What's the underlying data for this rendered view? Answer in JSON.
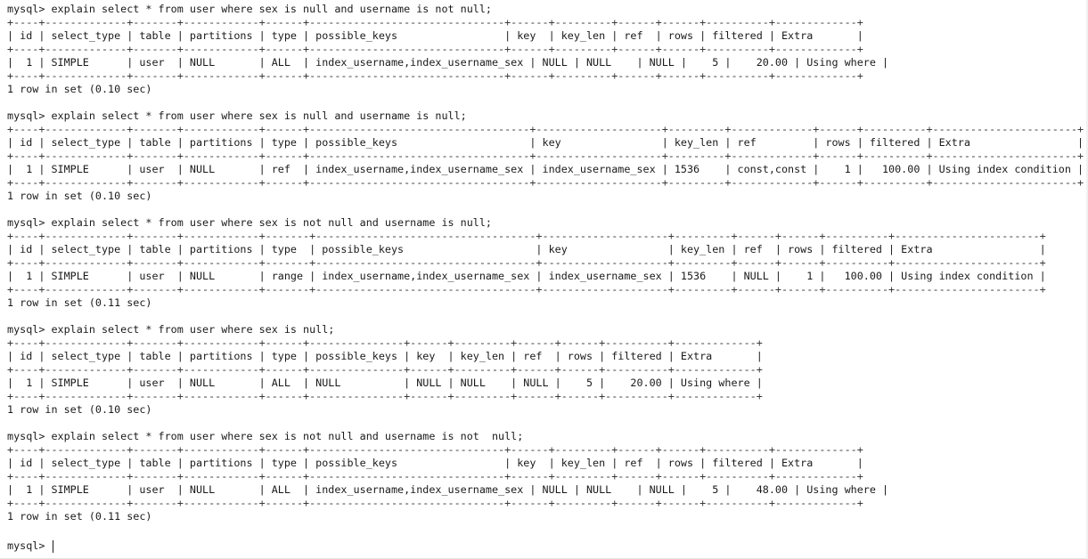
{
  "terminal": {
    "lines": [
      "mysql> explain select * from user where sex is null and username is not null;",
      "+----+-------------+-------+------------+------+-------------------------------+------+---------+------+------+----------+-------------+",
      "| id | select_type | table | partitions | type | possible_keys                 | key  | key_len | ref  | rows | filtered | Extra       |",
      "+----+-------------+-------+------------+------+-------------------------------+------+---------+------+------+----------+-------------+",
      "|  1 | SIMPLE      | user  | NULL       | ALL  | index_username,index_username_sex | NULL | NULL    | NULL |    5 |    20.00 | Using where |",
      "+----+-------------+-------+------------+------+-------------------------------+------+---------+------+------+----------+-------------+",
      "1 row in set (0.10 sec)",
      "",
      "mysql> explain select * from user where sex is null and username is null;",
      "+----+-------------+-------+------------+------+-----------------------------------+--------------------+---------+-------------+------+----------+-----------------------+",
      "| id | select_type | table | partitions | type | possible_keys                     | key                | key_len | ref         | rows | filtered | Extra                 |",
      "+----+-------------+-------+------------+------+-----------------------------------+--------------------+---------+-------------+------+----------+-----------------------+",
      "|  1 | SIMPLE      | user  | NULL       | ref  | index_username,index_username_sex | index_username_sex | 1536    | const,const |    1 |   100.00 | Using index condition |",
      "+----+-------------+-------+------------+------+-----------------------------------+--------------------+---------+-------------+------+----------+-----------------------+",
      "1 row in set (0.10 sec)",
      "",
      "mysql> explain select * from user where sex is not null and username is null;",
      "+----+-------------+-------+------------+-------+-----------------------------------+--------------------+---------+------+------+----------+-----------------------+",
      "| id | select_type | table | partitions | type  | possible_keys                     | key                | key_len | ref  | rows | filtered | Extra                 |",
      "+----+-------------+-------+------------+-------+-----------------------------------+--------------------+---------+------+------+----------+-----------------------+",
      "|  1 | SIMPLE      | user  | NULL       | range | index_username,index_username_sex | index_username_sex | 1536    | NULL |    1 |   100.00 | Using index condition |",
      "+----+-------------+-------+------------+-------+-----------------------------------+--------------------+---------+------+------+----------+-----------------------+",
      "1 row in set (0.11 sec)",
      "",
      "mysql> explain select * from user where sex is null;",
      "+----+-------------+-------+------------+------+---------------+------+---------+------+------+----------+-------------+",
      "| id | select_type | table | partitions | type | possible_keys | key  | key_len | ref  | rows | filtered | Extra       |",
      "+----+-------------+-------+------------+------+---------------+------+---------+------+------+----------+-------------+",
      "|  1 | SIMPLE      | user  | NULL       | ALL  | NULL          | NULL | NULL    | NULL |    5 |    20.00 | Using where |",
      "+----+-------------+-------+------------+------+---------------+------+---------+------+------+----------+-------------+",
      "1 row in set (0.10 sec)",
      "",
      "mysql> explain select * from user where sex is not null and username is not  null;",
      "+----+-------------+-------+------------+------+-------------------------------+------+---------+------+------+----------+-------------+",
      "| id | select_type | table | partitions | type | possible_keys                 | key  | key_len | ref  | rows | filtered | Extra       |",
      "+----+-------------+-------+------------+------+-------------------------------+------+---------+------+------+----------+-------------+",
      "|  1 | SIMPLE      | user  | NULL       | ALL  | index_username,index_username_sex | NULL | NULL    | NULL |    5 |    48.00 | Using where |",
      "+----+-------------+-------+------------+------+-------------------------------+------+---------+------+------+----------+-------------+",
      "1 row in set (0.11 sec)",
      ""
    ],
    "prompt": "mysql> "
  }
}
